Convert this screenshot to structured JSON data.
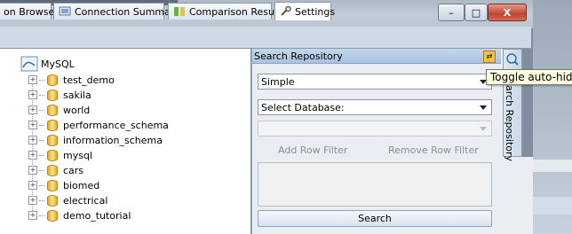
{
  "tabs": [
    {
      "label": "on Browser",
      "icon": "browser-icon"
    },
    {
      "label": "Connection Summary",
      "icon": "connection-summary-icon"
    },
    {
      "label": "Comparison Result",
      "icon": "comparison-icon"
    },
    {
      "label": "Settings",
      "icon": "wrench-icon"
    }
  ],
  "window_buttons": {
    "minimize": "–",
    "maximize": "□",
    "close": "X"
  },
  "tree": {
    "root": "MySQL",
    "items": [
      "test_demo",
      "sakila",
      "world",
      "performance_schema",
      "information_schema",
      "mysql",
      "cars",
      "biomed",
      "electrical",
      "demo_tutorial"
    ]
  },
  "search_repository": {
    "title": "Search Repository",
    "mode": "Simple",
    "database": "Select Database:",
    "table": "",
    "add_filter": "Add Row Filter",
    "remove_filter": "Remove Row Filter",
    "search_button": "Search"
  },
  "side_tab": {
    "label": "arch Repository"
  },
  "tooltip": "Toggle auto-hide"
}
